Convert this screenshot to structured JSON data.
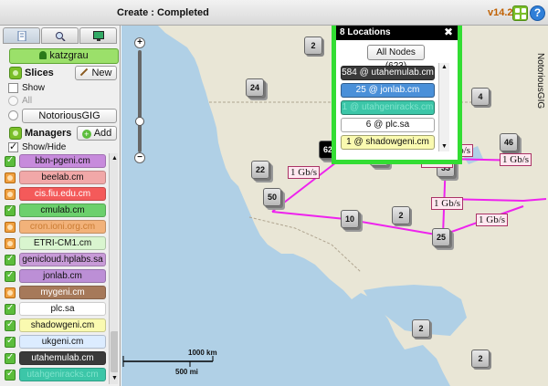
{
  "header": {
    "status": "Create : Completed",
    "version": "v14.26",
    "help_label": "?"
  },
  "sidebar": {
    "user": "katzgrau",
    "slices": {
      "title": "Slices",
      "new_label": "New",
      "show_label": "Show",
      "all_label": "All",
      "slice_name": "NotoriousGIG"
    },
    "managers": {
      "title": "Managers",
      "add_label": "Add",
      "show_hide_label": "Show/Hide",
      "items": [
        {
          "name": "bbn-pgeni.cm",
          "status": "ok",
          "color": "#c78bdc"
        },
        {
          "name": "beelab.cm",
          "status": "warn",
          "color": "#f1a8a8"
        },
        {
          "name": "cis.fiu.edu.cm",
          "status": "warn",
          "color": "#f45a5a"
        },
        {
          "name": "cmulab.cm",
          "status": "ok",
          "color": "#6cd06c"
        },
        {
          "name": "cron.ioni.org.cm",
          "status": "warn",
          "color": "#f2b27a"
        },
        {
          "name": "ETRI-CM1.cm",
          "status": "warn",
          "color": "#d9f5cf"
        },
        {
          "name": "genicloud.hplabs.sa",
          "status": "ok",
          "color": "#c89bd8"
        },
        {
          "name": "jonlab.cm",
          "status": "ok",
          "color": "#bc8fd6"
        },
        {
          "name": "mygeni.cm",
          "status": "warn",
          "color": "#a6795a"
        },
        {
          "name": "plc.sa",
          "status": "ok",
          "color": "#ffffff"
        },
        {
          "name": "shadowgeni.cm",
          "status": "ok",
          "color": "#fafab0"
        },
        {
          "name": "ukgeni.cm",
          "status": "ok",
          "color": "#dcecff"
        },
        {
          "name": "utahemulab.cm",
          "status": "ok",
          "color": "#3a3a3a"
        },
        {
          "name": "utahgeniracks.cm",
          "status": "ok",
          "color": "#3cc6a8"
        }
      ]
    }
  },
  "map": {
    "slice_label": "NotoriousGIG",
    "clusters": [
      {
        "label": "2"
      },
      {
        "label": "24"
      },
      {
        "label": "4"
      },
      {
        "label": "46"
      },
      {
        "label": "62"
      },
      {
        "label": "6"
      },
      {
        "label": "33"
      },
      {
        "label": "22"
      },
      {
        "label": "50"
      },
      {
        "label": "10"
      },
      {
        "label": "2"
      },
      {
        "label": "25"
      },
      {
        "label": "2"
      },
      {
        "label": "2"
      }
    ],
    "link_label": "1 Gb/s",
    "scale_km": "1000 km",
    "scale_mi": "500 mi"
  },
  "popup": {
    "title": "8 Locations",
    "close": "✖",
    "all_nodes": "All Nodes (623)",
    "items": [
      {
        "label": "584 @ utahemulab.cm",
        "color": "#3a3a3a",
        "text_color": "#ffffff"
      },
      {
        "label": "25 @ jonlab.cm",
        "color": "#4a90d9",
        "text_color": "#ffffff"
      },
      {
        "label": "1 @ utahgeniracks.cm",
        "color": "#3cc6a8",
        "text_color": "#7fe3cc"
      },
      {
        "label": "6 @ plc.sa",
        "color": "#ffffff",
        "text_color": "#111111"
      },
      {
        "label": "1 @ shadowgeni.cm",
        "color": "#fafab0",
        "text_color": "#111111"
      }
    ]
  }
}
